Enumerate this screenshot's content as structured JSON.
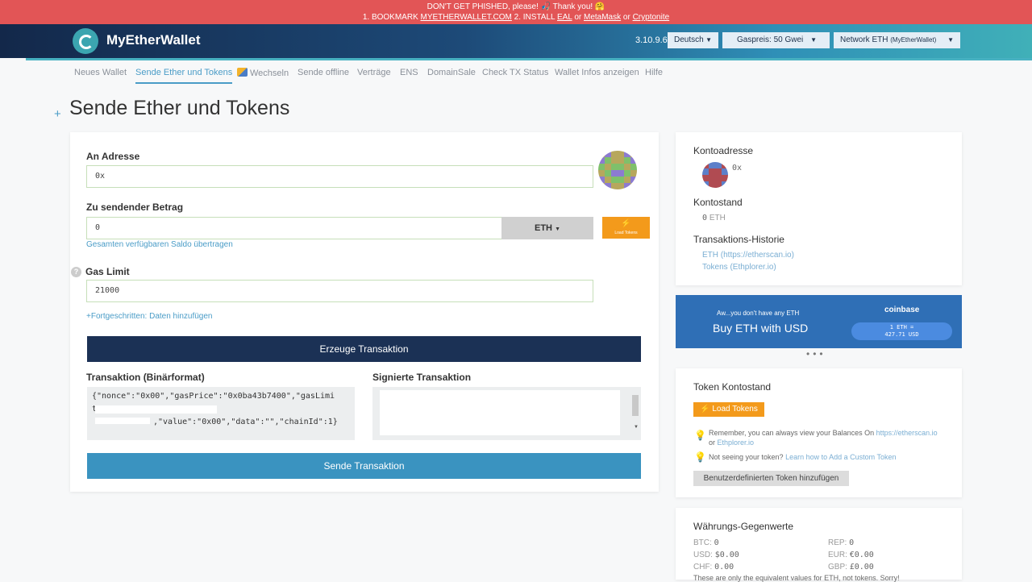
{
  "banner": {
    "line1": "DON'T GET PHISHED, please! 🎣 Thank you! 🤗",
    "line2_prefix": "1. BOOKMARK ",
    "line2_bookmark": "MYETHERWALLET.COM",
    "line2_mid": "  2. INSTALL ",
    "line2_eal": "EAL",
    "line2_or1": " or ",
    "line2_metamask": "MetaMask",
    "line2_or2": " or ",
    "line2_cryptonite": "Cryptonite"
  },
  "header": {
    "brand": "MyEtherWallet",
    "version": "3.10.9.6",
    "language": "Deutsch",
    "gas": "Gaspreis: 50 Gwei",
    "network": "Network ETH",
    "network_sub": "(MyEtherWallet)"
  },
  "nav": [
    "Neues Wallet",
    "Sende Ether und Tokens",
    "Wechseln",
    "Sende offline",
    "Verträge",
    "ENS",
    "DomainSale",
    "Check TX Status",
    "Wallet Infos anzeigen",
    "Hilfe"
  ],
  "page_title": "Sende Ether und Tokens",
  "form": {
    "to_label": "An Adresse",
    "to_value": "0x",
    "amount_label": "Zu sendender Betrag",
    "amount_value": "0",
    "unit": "ETH",
    "load_tokens_small": "Load Tokens",
    "send_all": "Gesamten verfügbaren Saldo übertragen",
    "gas_label": "Gas Limit",
    "gas_value": "21000",
    "advanced": "+Fortgeschritten: Daten hinzufügen",
    "generate_btn": "Erzeuge Transaktion",
    "raw_label": "Transaktion (Binärformat)",
    "raw_line1": "{\"nonce\":\"0x00\",\"gasPrice\":\"0x0ba43b7400\",\"gasLimi",
    "raw_line2": "t\":\"0x5208\",\"to\":\"0x",
    "raw_line3": ",\"value\":\"0x00\",\"data\":\"\",\"chainId\":1}",
    "signed_label": "Signierte Transaktion",
    "send_btn": "Sende Transaktion"
  },
  "account": {
    "addr_title": "Kontoadresse",
    "addr_value": "0x",
    "balance_title": "Kontostand",
    "balance_value": "0",
    "balance_unit": "ETH",
    "history_title": "Transaktions-Historie",
    "history_eth": "ETH (https://etherscan.io)",
    "history_tokens": "Tokens (Ethplorer.io)"
  },
  "coinbase": {
    "sub": "Aw...you don't have any ETH",
    "main": "Buy ETH with USD",
    "brand": "coinbase",
    "rate1": "1 ETH =",
    "rate2": "427.71 USD"
  },
  "tokens": {
    "title": "Token Kontostand",
    "load_btn": "Load Tokens",
    "tip1_a": "Remember, you can always view your Balances On ",
    "tip1_link1": "https://etherscan.io",
    "tip1_or": "or ",
    "tip1_link2": "Ethplorer.io",
    "tip2_a": "Not seeing your token? ",
    "tip2_link": "Learn how to Add a Custom Token",
    "custom_btn": "Benutzerdefinierten Token hinzufügen"
  },
  "currency": {
    "title": "Währungs-Gegenwerte",
    "btc_label": "BTC:",
    "btc": "0",
    "rep_label": "REP:",
    "rep": "0",
    "usd_label": "USD:",
    "usd": "$0.00",
    "eur_label": "EUR:",
    "eur": "€0.00",
    "chf_label": "CHF:",
    "chf": "0.00",
    "gbp_label": "GBP:",
    "gbp": "£0.00",
    "note": "These are only the equivalent values for ETH, not tokens. Sorry!"
  },
  "colors": {
    "accent": "#4a9cc7",
    "primary_dark": "#1b3155",
    "send_blue": "#3a93c0",
    "orange": "#f39a1b",
    "banner_red": "#e25556"
  }
}
